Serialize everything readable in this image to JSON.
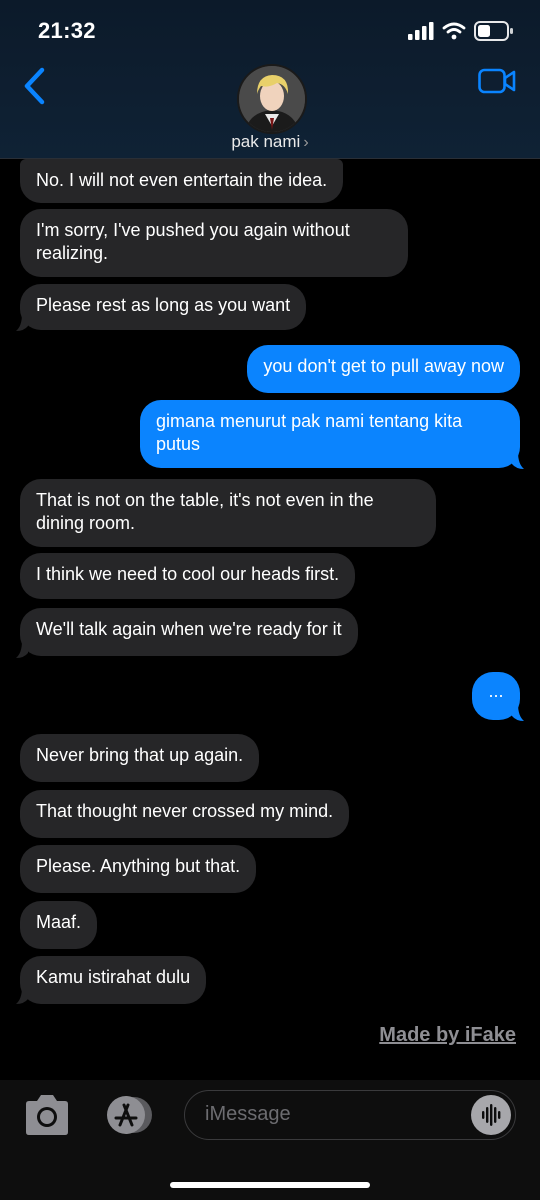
{
  "status_bar": {
    "time": "21:32"
  },
  "header": {
    "contact_name": "pak nami",
    "contact_chevron": "›"
  },
  "messages": [
    {
      "side": "received",
      "text": "No. I will not even entertain the idea."
    },
    {
      "side": "received",
      "text": "I'm sorry, I've pushed you again without realizing."
    },
    {
      "side": "received",
      "text": "Please rest as long as you want"
    },
    {
      "side": "sent",
      "text": "you don't get to pull away now"
    },
    {
      "side": "sent",
      "text": "gimana menurut pak nami tentang kita putus"
    },
    {
      "side": "received",
      "text": "That is not on the table, it's not even in the dining room."
    },
    {
      "side": "received",
      "text": "I think we need to cool our heads first."
    },
    {
      "side": "received",
      "text": "We'll talk again when we're ready for it"
    },
    {
      "side": "sent",
      "text": "..."
    },
    {
      "side": "received",
      "text": "Never bring that up again."
    },
    {
      "side": "received",
      "text": "That thought never crossed my mind."
    },
    {
      "side": "received",
      "text": "Please. Anything but that."
    },
    {
      "side": "received",
      "text": "Maaf."
    },
    {
      "side": "received",
      "text": "Kamu istirahat dulu"
    }
  ],
  "watermark": "Made by iFake",
  "composer": {
    "placeholder": "iMessage"
  },
  "icons": [
    "signal-icon",
    "wifi-icon",
    "battery-icon",
    "back-chevron-icon",
    "video-call-icon",
    "camera-icon",
    "app-store-icon",
    "audio-waveform-icon"
  ],
  "colors": {
    "sent_bubble": "#0b84fe",
    "received_bubble": "#262628",
    "accent": "#0a84ff",
    "background": "#000000"
  }
}
